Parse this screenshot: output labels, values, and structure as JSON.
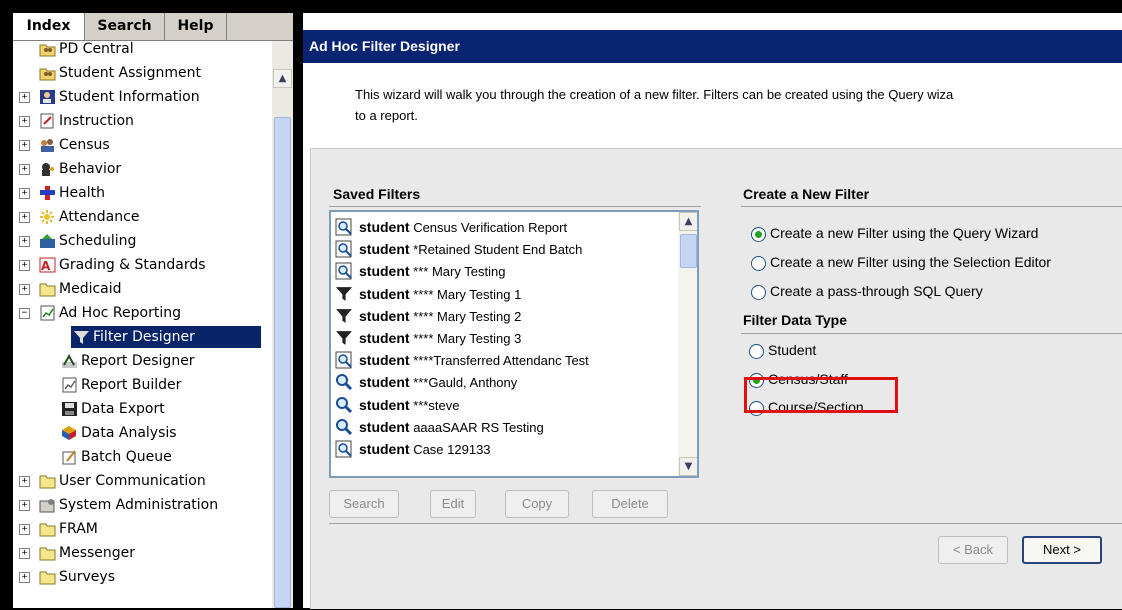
{
  "tabs": [
    "Index",
    "Search",
    "Help"
  ],
  "tree": [
    {
      "label": "PD Central",
      "expander": "",
      "icon": "folder-people-icon"
    },
    {
      "label": "Student Assignment",
      "expander": "",
      "icon": "folder-people-icon"
    },
    {
      "label": "Student Information",
      "expander": "+",
      "icon": "student-info-icon"
    },
    {
      "label": "Instruction",
      "expander": "+",
      "icon": "instruction-icon"
    },
    {
      "label": "Census",
      "expander": "+",
      "icon": "census-icon"
    },
    {
      "label": "Behavior",
      "expander": "+",
      "icon": "behavior-icon"
    },
    {
      "label": "Health",
      "expander": "+",
      "icon": "health-icon"
    },
    {
      "label": "Attendance",
      "expander": "+",
      "icon": "attendance-icon"
    },
    {
      "label": "Scheduling",
      "expander": "+",
      "icon": "scheduling-icon"
    },
    {
      "label": "Grading & Standards",
      "expander": "+",
      "icon": "grading-icon"
    },
    {
      "label": "Medicaid",
      "expander": "+",
      "icon": "folder-icon"
    },
    {
      "label": "Ad Hoc Reporting",
      "expander": "−",
      "icon": "ad-hoc-reporting-icon"
    },
    {
      "label": "Filter Designer",
      "expander": "",
      "icon": "funnel-icon",
      "child": true,
      "selected": true
    },
    {
      "label": "Report Designer",
      "expander": "",
      "icon": "report-designer-icon",
      "child": true
    },
    {
      "label": "Report Builder",
      "expander": "",
      "icon": "report-builder-icon",
      "child": true
    },
    {
      "label": "Data Export",
      "expander": "",
      "icon": "floppy-disk-icon",
      "child": true
    },
    {
      "label": "Data Analysis",
      "expander": "",
      "icon": "cube-icon",
      "child": true
    },
    {
      "label": "Batch Queue",
      "expander": "",
      "icon": "batch-queue-icon",
      "child": true
    },
    {
      "label": "User Communication",
      "expander": "+",
      "icon": "folder-icon"
    },
    {
      "label": "System Administration",
      "expander": "+",
      "icon": "system-admin-icon"
    },
    {
      "label": "FRAM",
      "expander": "+",
      "icon": "folder-icon"
    },
    {
      "label": "Messenger",
      "expander": "+",
      "icon": "folder-icon"
    },
    {
      "label": "Surveys",
      "expander": "+",
      "icon": "folder-icon"
    }
  ],
  "page": {
    "title": "Ad Hoc Filter Designer",
    "intro_line1": "This wizard will walk you through the creation of a new filter. Filters can be created using the Query wiza",
    "intro_line2": "to a report."
  },
  "saved_filters": {
    "heading": "Saved Filters",
    "items": [
      {
        "type": "student",
        "name": "Census Verification Report",
        "icon": "query-icon"
      },
      {
        "type": "student",
        "name": "*Retained Student End Batch",
        "icon": "query-icon"
      },
      {
        "type": "student",
        "name": "*** Mary Testing",
        "icon": "query-icon"
      },
      {
        "type": "student",
        "name": "**** Mary Testing 1",
        "icon": "funnel-icon"
      },
      {
        "type": "student",
        "name": "**** Mary Testing 2",
        "icon": "funnel-icon"
      },
      {
        "type": "student",
        "name": "**** Mary Testing 3",
        "icon": "funnel-icon"
      },
      {
        "type": "student",
        "name": "****Transferred Attendanc Test",
        "icon": "query-icon"
      },
      {
        "type": "student",
        "name": "***Gauld, Anthony",
        "icon": "search-icon"
      },
      {
        "type": "student",
        "name": "***steve",
        "icon": "search-icon"
      },
      {
        "type": "student",
        "name": "aaaaSAAR RS Testing",
        "icon": "search-icon"
      },
      {
        "type": "student",
        "name": "Case 129133",
        "icon": "query-icon"
      }
    ],
    "buttons": {
      "search": "Search",
      "edit": "Edit",
      "copy": "Copy",
      "delete": "Delete"
    }
  },
  "create_new": {
    "heading": "Create a New Filter",
    "options": [
      {
        "label": "Create a new Filter using the Query Wizard",
        "checked": true
      },
      {
        "label": "Create a new Filter using the Selection Editor",
        "checked": false
      },
      {
        "label": "Create a pass-through SQL Query",
        "checked": false
      }
    ]
  },
  "data_type": {
    "heading": "Filter Data Type",
    "options": [
      {
        "label": "Student",
        "checked": false
      },
      {
        "label": "Census/Staff",
        "checked": true
      },
      {
        "label": "Course/Section",
        "checked": false
      }
    ]
  },
  "nav": {
    "back": "< Back",
    "next": "Next >"
  },
  "colors": {
    "title_bar": "#0a2474",
    "selection": "#0a246a",
    "highlight_box": "#e01010",
    "radio_dot": "#21a121"
  }
}
